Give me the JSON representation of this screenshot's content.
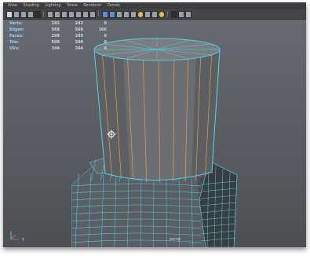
{
  "menu": [
    "View",
    "Shading",
    "Lighting",
    "Show",
    "Renderer",
    "Panels"
  ],
  "hud": {
    "rows": [
      {
        "label": "Verts:",
        "a": "242",
        "b": "242",
        "c": "0"
      },
      {
        "label": "Edges:",
        "a": "568",
        "b": "568",
        "c": "166"
      },
      {
        "label": "Faces:",
        "a": "299",
        "b": "299",
        "c": "0"
      },
      {
        "label": "Tris:",
        "a": "508",
        "b": "508",
        "c": "0"
      },
      {
        "label": "UVs:",
        "a": "344",
        "b": "344",
        "c": "0"
      }
    ]
  },
  "axis_label": "Y",
  "camera_label": "persp",
  "colors": {
    "viewport_top": "#666a70",
    "viewport_bottom": "#4d4f53",
    "wire": "#4fd2e8",
    "highlight": "#d8a352"
  },
  "icons": [
    "select-icon",
    "lasso-icon",
    "paint-icon",
    "move-icon",
    "rotate-icon",
    "scale-icon",
    "camera-icon",
    "grid-icon",
    "wireframe-icon",
    "shaded-icon",
    "light-icon",
    "isolate-icon"
  ]
}
